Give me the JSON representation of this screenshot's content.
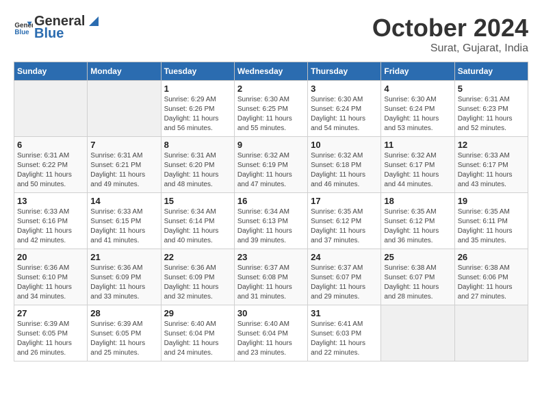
{
  "header": {
    "logo_general": "General",
    "logo_blue": "Blue",
    "month": "October 2024",
    "location": "Surat, Gujarat, India"
  },
  "days_of_week": [
    "Sunday",
    "Monday",
    "Tuesday",
    "Wednesday",
    "Thursday",
    "Friday",
    "Saturday"
  ],
  "weeks": [
    [
      null,
      null,
      {
        "day": 1,
        "sunrise": "6:29 AM",
        "sunset": "6:26 PM",
        "daylight": "11 hours and 56 minutes."
      },
      {
        "day": 2,
        "sunrise": "6:30 AM",
        "sunset": "6:25 PM",
        "daylight": "11 hours and 55 minutes."
      },
      {
        "day": 3,
        "sunrise": "6:30 AM",
        "sunset": "6:24 PM",
        "daylight": "11 hours and 54 minutes."
      },
      {
        "day": 4,
        "sunrise": "6:30 AM",
        "sunset": "6:24 PM",
        "daylight": "11 hours and 53 minutes."
      },
      {
        "day": 5,
        "sunrise": "6:31 AM",
        "sunset": "6:23 PM",
        "daylight": "11 hours and 52 minutes."
      }
    ],
    [
      {
        "day": 6,
        "sunrise": "6:31 AM",
        "sunset": "6:22 PM",
        "daylight": "11 hours and 50 minutes."
      },
      {
        "day": 7,
        "sunrise": "6:31 AM",
        "sunset": "6:21 PM",
        "daylight": "11 hours and 49 minutes."
      },
      {
        "day": 8,
        "sunrise": "6:31 AM",
        "sunset": "6:20 PM",
        "daylight": "11 hours and 48 minutes."
      },
      {
        "day": 9,
        "sunrise": "6:32 AM",
        "sunset": "6:19 PM",
        "daylight": "11 hours and 47 minutes."
      },
      {
        "day": 10,
        "sunrise": "6:32 AM",
        "sunset": "6:18 PM",
        "daylight": "11 hours and 46 minutes."
      },
      {
        "day": 11,
        "sunrise": "6:32 AM",
        "sunset": "6:17 PM",
        "daylight": "11 hours and 44 minutes."
      },
      {
        "day": 12,
        "sunrise": "6:33 AM",
        "sunset": "6:17 PM",
        "daylight": "11 hours and 43 minutes."
      }
    ],
    [
      {
        "day": 13,
        "sunrise": "6:33 AM",
        "sunset": "6:16 PM",
        "daylight": "11 hours and 42 minutes."
      },
      {
        "day": 14,
        "sunrise": "6:33 AM",
        "sunset": "6:15 PM",
        "daylight": "11 hours and 41 minutes."
      },
      {
        "day": 15,
        "sunrise": "6:34 AM",
        "sunset": "6:14 PM",
        "daylight": "11 hours and 40 minutes."
      },
      {
        "day": 16,
        "sunrise": "6:34 AM",
        "sunset": "6:13 PM",
        "daylight": "11 hours and 39 minutes."
      },
      {
        "day": 17,
        "sunrise": "6:35 AM",
        "sunset": "6:12 PM",
        "daylight": "11 hours and 37 minutes."
      },
      {
        "day": 18,
        "sunrise": "6:35 AM",
        "sunset": "6:12 PM",
        "daylight": "11 hours and 36 minutes."
      },
      {
        "day": 19,
        "sunrise": "6:35 AM",
        "sunset": "6:11 PM",
        "daylight": "11 hours and 35 minutes."
      }
    ],
    [
      {
        "day": 20,
        "sunrise": "6:36 AM",
        "sunset": "6:10 PM",
        "daylight": "11 hours and 34 minutes."
      },
      {
        "day": 21,
        "sunrise": "6:36 AM",
        "sunset": "6:09 PM",
        "daylight": "11 hours and 33 minutes."
      },
      {
        "day": 22,
        "sunrise": "6:36 AM",
        "sunset": "6:09 PM",
        "daylight": "11 hours and 32 minutes."
      },
      {
        "day": 23,
        "sunrise": "6:37 AM",
        "sunset": "6:08 PM",
        "daylight": "11 hours and 31 minutes."
      },
      {
        "day": 24,
        "sunrise": "6:37 AM",
        "sunset": "6:07 PM",
        "daylight": "11 hours and 29 minutes."
      },
      {
        "day": 25,
        "sunrise": "6:38 AM",
        "sunset": "6:07 PM",
        "daylight": "11 hours and 28 minutes."
      },
      {
        "day": 26,
        "sunrise": "6:38 AM",
        "sunset": "6:06 PM",
        "daylight": "11 hours and 27 minutes."
      }
    ],
    [
      {
        "day": 27,
        "sunrise": "6:39 AM",
        "sunset": "6:05 PM",
        "daylight": "11 hours and 26 minutes."
      },
      {
        "day": 28,
        "sunrise": "6:39 AM",
        "sunset": "6:05 PM",
        "daylight": "11 hours and 25 minutes."
      },
      {
        "day": 29,
        "sunrise": "6:40 AM",
        "sunset": "6:04 PM",
        "daylight": "11 hours and 24 minutes."
      },
      {
        "day": 30,
        "sunrise": "6:40 AM",
        "sunset": "6:04 PM",
        "daylight": "11 hours and 23 minutes."
      },
      {
        "day": 31,
        "sunrise": "6:41 AM",
        "sunset": "6:03 PM",
        "daylight": "11 hours and 22 minutes."
      },
      null,
      null
    ]
  ],
  "labels": {
    "sunrise_prefix": "Sunrise:",
    "sunset_prefix": "Sunset:",
    "daylight_prefix": "Daylight:"
  }
}
